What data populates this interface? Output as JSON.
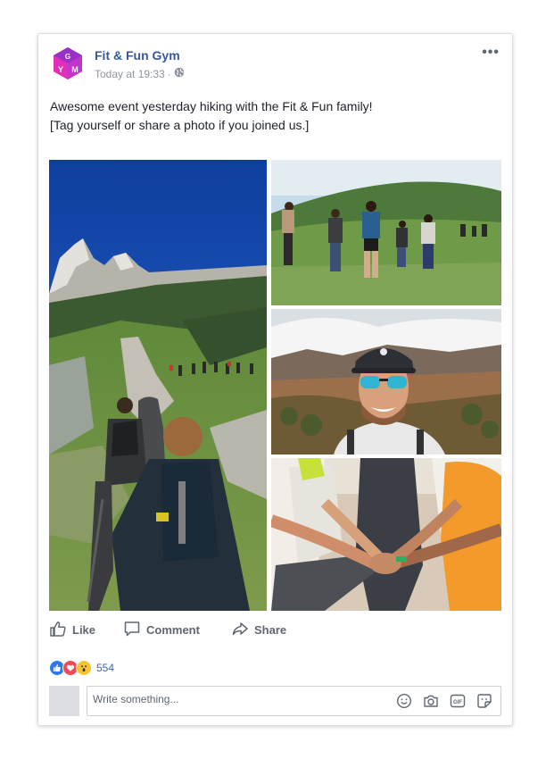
{
  "post": {
    "page_name": "Fit & Fun Gym",
    "timestamp": "Today at 19:33",
    "separator": "·",
    "more": "•••",
    "text_line1": "Awesome event yesterday hiking with the Fit & Fun family!",
    "text_line2": "[Tag yourself or share a photo if you joined us.]",
    "logo_letters": {
      "top": "G",
      "left": "Y",
      "right": "M"
    }
  },
  "actions": {
    "like": "Like",
    "comment": "Comment",
    "share": "Share"
  },
  "reactions": {
    "count": "554",
    "types": [
      "like-icon",
      "love-icon",
      "wow-icon"
    ]
  },
  "composer": {
    "placeholder": "Write something..."
  },
  "colors": {
    "brand_link": "#385898",
    "logo_purple": "#9b2fc9",
    "logo_magenta": "#e02fb8",
    "like_blue": "#2f78f5",
    "love_red": "#ed4a5a",
    "wow_yellow": "#f7c533"
  },
  "icons": [
    "more-icon",
    "globe-icon",
    "like-outline-icon",
    "comment-icon",
    "share-icon",
    "emoji-icon",
    "camera-icon",
    "gif-icon",
    "sticker-icon"
  ]
}
